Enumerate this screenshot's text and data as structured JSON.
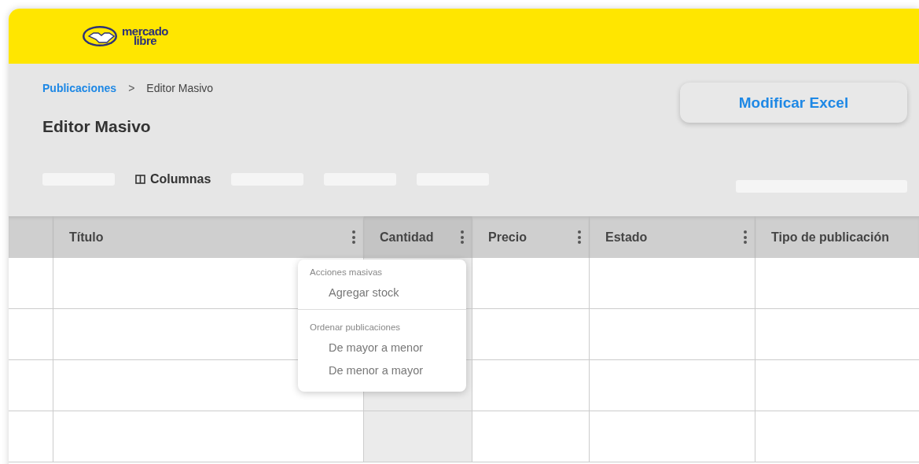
{
  "header": {
    "logo": {
      "line_1": "mercado",
      "line_2": "libre"
    }
  },
  "breadcrumb": [
    {
      "label": "Publicaciones",
      "kind": "link"
    },
    {
      "label": ">",
      "kind": "separator"
    },
    {
      "label": "Editor Masivo",
      "kind": "current"
    }
  ],
  "page_title": "Editor Masivo",
  "primary_button": "Modificar Excel",
  "toolbar": [
    {
      "kind": "placeholder"
    },
    {
      "kind": "button",
      "label": "Columnas"
    },
    {
      "kind": "placeholder"
    },
    {
      "kind": "placeholder"
    },
    {
      "kind": "placeholder"
    }
  ],
  "table": {
    "columns": [
      {
        "has_menu": false,
        "selected": false
      },
      {
        "label": "Título",
        "has_menu": true,
        "selected": false
      },
      {
        "label": "Cantidad",
        "has_menu": true,
        "selected": true
      },
      {
        "label": "Precio",
        "has_menu": true,
        "selected": false
      },
      {
        "label": "Estado",
        "has_menu": true,
        "selected": false
      },
      {
        "label": "Tipo de publicación",
        "has_menu": false,
        "selected": false
      }
    ]
  },
  "column_menu": {
    "sections": [
      {
        "heading": "Acciones masivas",
        "items": [
          "Agregar stock"
        ]
      },
      {
        "heading": "Ordenar publicaciones",
        "items": [
          "De mayor a menor",
          "De menor a mayor"
        ]
      }
    ]
  }
}
